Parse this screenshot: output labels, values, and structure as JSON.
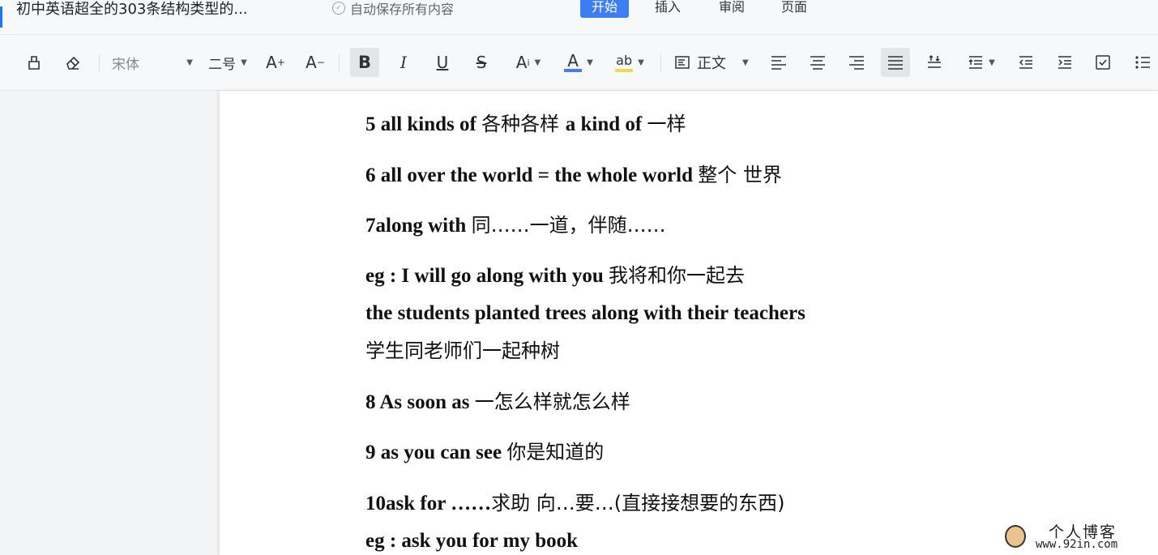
{
  "window": {
    "doc_title": "初中英语超全的303条结构类型的...",
    "autosave": "自动保存所有内容",
    "tabs": [
      "开始",
      "插入",
      "审阅",
      "页面"
    ]
  },
  "toolbar": {
    "font_family": "宋体",
    "font_size": "二号",
    "paragraph_style": "正文",
    "icons": [
      "format-painter-icon",
      "eraser-icon",
      "increase-font-icon",
      "decrease-font-icon",
      "bold-icon",
      "italic-icon",
      "underline-icon",
      "strikethrough-icon",
      "superscript-icon",
      "font-color-icon",
      "highlight-icon",
      "paragraph-style-icon",
      "align-left-icon",
      "align-center-icon",
      "align-right-icon",
      "justify-icon",
      "line-spacing-icon",
      "paragraph-spacing-icon",
      "outdent-icon",
      "indent-icon",
      "checklist-icon",
      "bullet-list-icon"
    ],
    "colors": {
      "font_color": "#3d7ef5",
      "highlight": "#f5d94a"
    }
  },
  "document": {
    "lines": [
      {
        "en": "5 all kinds of ",
        "cn": " 各种各样  ",
        "en2": "a kind of ",
        "cn2": " 一样"
      },
      {
        "en": "6 all over the world = the whole world ",
        "cn": " 整个  世界",
        "en2": "",
        "cn2": ""
      },
      {
        "en": "7along with ",
        "cn": " 同……一道，伴随……",
        "en2": "",
        "cn2": ""
      },
      {
        "en": "eg : I will go along with you ",
        "cn": " 我将和你一起去",
        "en2": "",
        "cn2": ""
      },
      {
        "en": "the students planted trees along with their teachers",
        "cn": "",
        "en2": "",
        "cn2": ""
      },
      {
        "en": "",
        "cn": "学生同老师们一起种树",
        "en2": "",
        "cn2": ""
      },
      {
        "en": "8 As soon as ",
        "cn": " 一怎么样就怎么样",
        "en2": "",
        "cn2": ""
      },
      {
        "en": "9 as you can see ",
        "cn": " 你是知道的",
        "en2": "",
        "cn2": ""
      },
      {
        "en": "10ask for ……",
        "cn": "求助  向…要…(直接接想要的东西)",
        "en2": "",
        "cn2": ""
      },
      {
        "en": "eg : ask you for my book",
        "cn": "",
        "en2": "",
        "cn2": ""
      }
    ]
  },
  "watermark": {
    "text": "个人博客",
    "url": "www.92in.com"
  }
}
